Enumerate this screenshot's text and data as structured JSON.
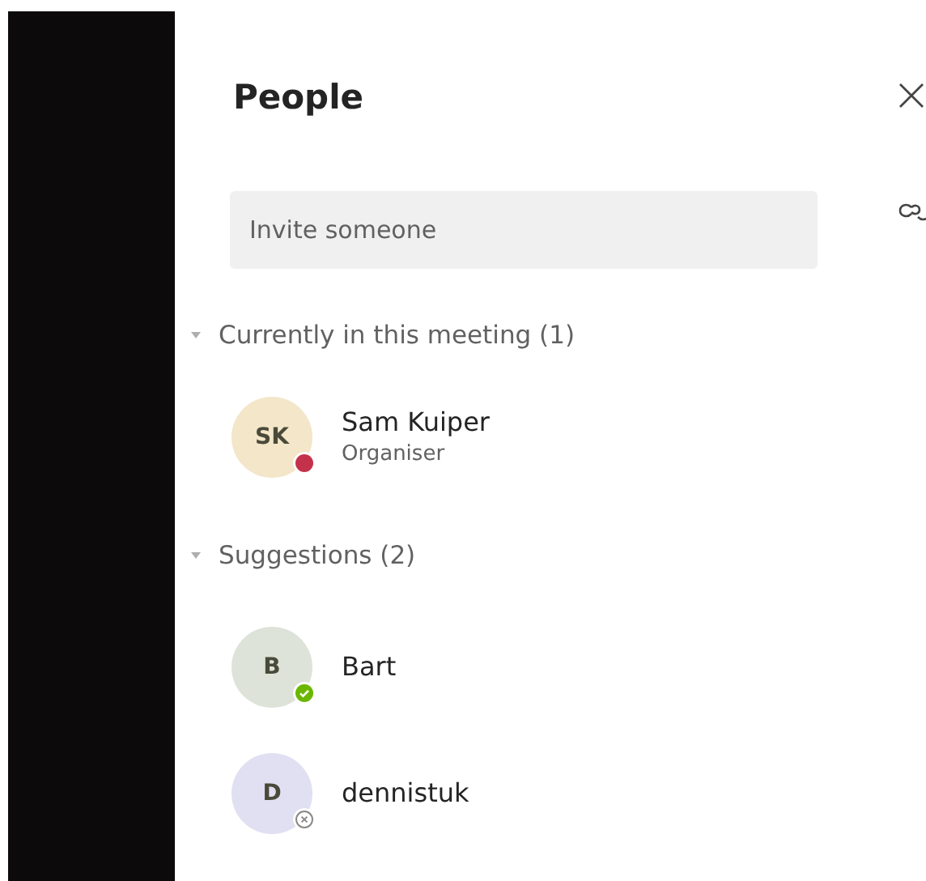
{
  "panel": {
    "title": "People"
  },
  "invite": {
    "placeholder": "Invite someone"
  },
  "sections": [
    {
      "title": "Currently in this meeting (1)",
      "expanded": true,
      "people": [
        {
          "initials": "SK",
          "name": "Sam Kuiper",
          "role": "Organiser",
          "color": "#f3e6c9",
          "kind": "busy"
        }
      ]
    },
    {
      "title": "Suggestions (2)",
      "expanded": true,
      "people": [
        {
          "initials": "B",
          "name": "Bart",
          "color": "#dde3d9",
          "kind": "available"
        },
        {
          "initials": "D",
          "name": "dennistuk",
          "color": "#e1dff2",
          "kind": "offline"
        }
      ]
    }
  ]
}
